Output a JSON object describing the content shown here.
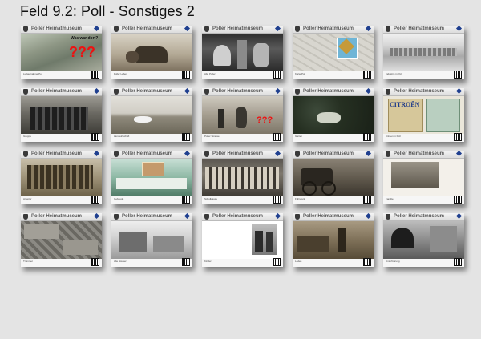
{
  "page": {
    "title": "Feld 9.2: Poll - Sonstiges 2"
  },
  "cards": [
    {
      "museum": "Poller Heimatmuseum",
      "photo_kind": "aerial",
      "mark": "???",
      "question": "Was war dort?",
      "caption": "Luftaufnahme Poll"
    },
    {
      "museum": "Poller Heimatmuseum",
      "photo_kind": "carriage",
      "caption": "Poller Leben"
    },
    {
      "museum": "Poller Heimatmuseum",
      "photo_kind": "horses",
      "caption": "Alte Poller"
    },
    {
      "museum": "Poller Heimatmuseum",
      "photo_kind": "map",
      "caption": "Karte Poll"
    },
    {
      "museum": "Poller Heimatmuseum",
      "photo_kind": "factory",
      "caption": "Industrie in Poll"
    },
    {
      "museum": "Poller Heimatmuseum",
      "photo_kind": "group",
      "caption": "Gruppe"
    },
    {
      "museum": "Poller Heimatmuseum",
      "photo_kind": "field",
      "caption": "Landwirtschaft"
    },
    {
      "museum": "Poller Heimatmuseum",
      "photo_kind": "street",
      "mark": "???",
      "caption": "Poller Strasse"
    },
    {
      "museum": "Poller Heimatmuseum",
      "photo_kind": "garden",
      "caption": "Garten"
    },
    {
      "museum": "Poller Heimatmuseum",
      "photo_kind": "citroen",
      "logo": "CITROËN",
      "caption": "Citroen in Poll"
    },
    {
      "museum": "Poller Heimatmuseum",
      "photo_kind": "workers",
      "caption": "Arbeiter"
    },
    {
      "museum": "Poller Heimatmuseum",
      "photo_kind": "building",
      "caption": "Gebäude"
    },
    {
      "museum": "Poller Heimatmuseum",
      "photo_kind": "school",
      "caption": "Schulklasse"
    },
    {
      "museum": "Poller Heimatmuseum",
      "photo_kind": "cart",
      "caption": "Fuhrwerk"
    },
    {
      "museum": "Poller Heimatmuseum",
      "photo_kind": "portrait",
      "caption": "Familie"
    },
    {
      "museum": "Poller Heimatmuseum",
      "photo_kind": "ruins",
      "caption": "Trümmer"
    },
    {
      "museum": "Poller Heimatmuseum",
      "photo_kind": "houses",
      "caption": "Alte Häuser"
    },
    {
      "museum": "Poller Heimatmuseum",
      "photo_kind": "children",
      "caption": "Kinder"
    },
    {
      "museum": "Poller Heimatmuseum",
      "photo_kind": "shop",
      "caption": "Laden"
    },
    {
      "museum": "Poller Heimatmuseum",
      "photo_kind": "tunnel",
      "caption": "Unterführung"
    }
  ],
  "colors": {
    "background": "#e4e4e4",
    "accent": "#1f3f8f",
    "mark": "#e11111"
  }
}
